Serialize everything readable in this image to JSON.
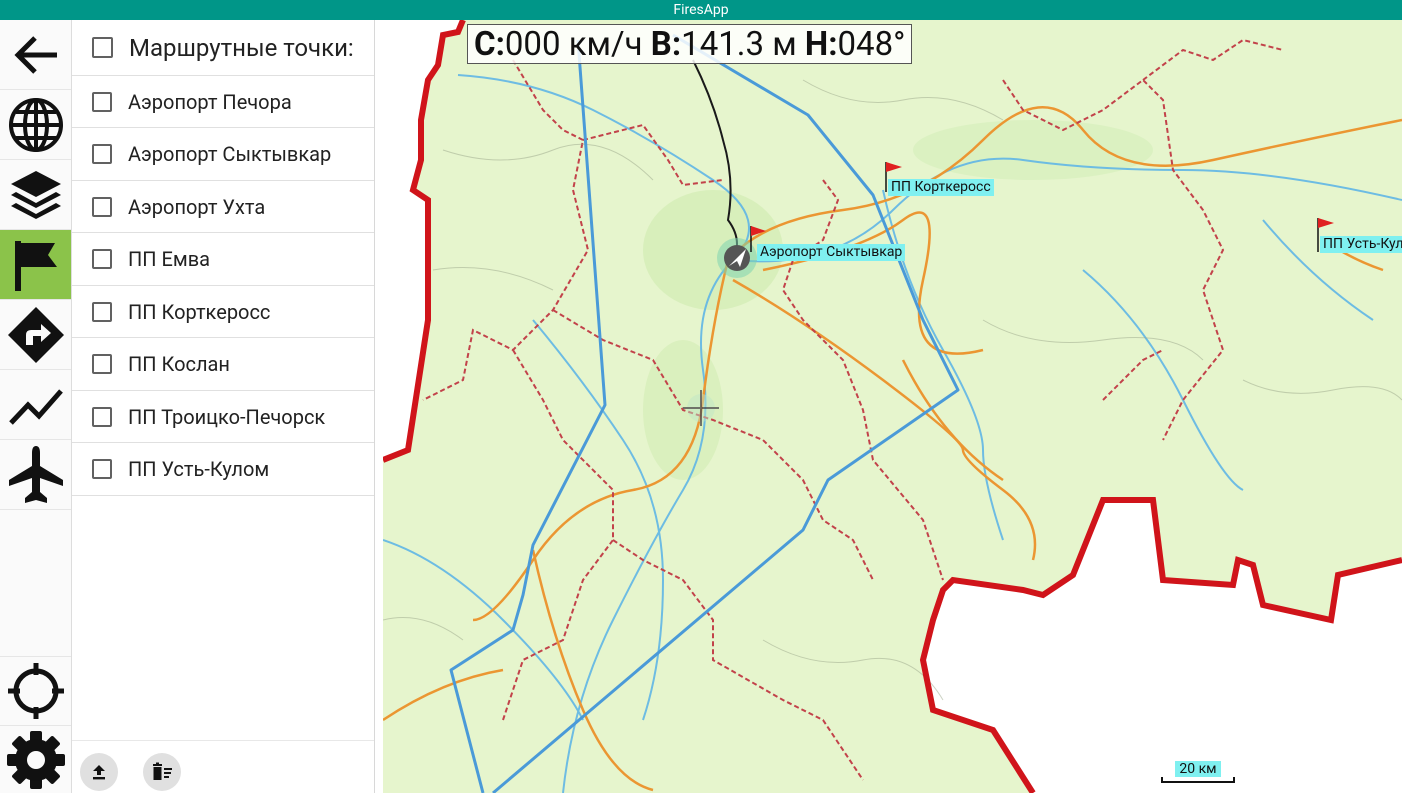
{
  "app": {
    "title": "FiresApp"
  },
  "rail": {
    "buttons": [
      {
        "name": "back",
        "icon": "arrow-left-icon"
      },
      {
        "name": "globe",
        "icon": "globe-icon"
      },
      {
        "name": "layers",
        "icon": "layers-icon"
      },
      {
        "name": "route-points",
        "icon": "flag-icon",
        "active": true
      },
      {
        "name": "navigation",
        "icon": "directions-icon"
      },
      {
        "name": "track",
        "icon": "chart-line-icon"
      },
      {
        "name": "flights",
        "icon": "airplane-icon"
      },
      {
        "name": "my-location",
        "icon": "crosshairs-icon"
      },
      {
        "name": "settings",
        "icon": "gear-icon"
      }
    ],
    "active_color": "#8bc34a"
  },
  "panel": {
    "header_label": "Маршрутные точки:",
    "items": [
      {
        "label": "Аэропорт Печора",
        "checked": false
      },
      {
        "label": "Аэропорт Сыктывкар",
        "checked": false
      },
      {
        "label": "Аэропорт Ухта",
        "checked": false
      },
      {
        "label": "ПП Емва",
        "checked": false
      },
      {
        "label": "ПП Корткеросс",
        "checked": false
      },
      {
        "label": "ПП Кослан",
        "checked": false
      },
      {
        "label": "ПП Троицко-Печорск",
        "checked": false
      },
      {
        "label": "ПП Усть-Кулом",
        "checked": false
      }
    ],
    "footer": {
      "upload_icon": "upload-icon",
      "delete_icon": "delete-list-icon"
    }
  },
  "map": {
    "hud": {
      "speed_key": "С:",
      "speed_value": "000 км/ч",
      "altitude_key": "В:",
      "altitude_value": "141.3 м",
      "heading_key": "Н:",
      "heading_value": "048°"
    },
    "labels": {
      "kortkeross": "ПП Корткеросс",
      "syktyvkar": "Аэропорт Сыктывкар",
      "ust_kulom": "ПП Усть-Кулом"
    },
    "scale": "20 км",
    "colors": {
      "region_border": "#d0141a",
      "route": "#4a9ad8",
      "land": "#e7f5cf",
      "marker_label_bg": "#7ff0f0"
    }
  }
}
